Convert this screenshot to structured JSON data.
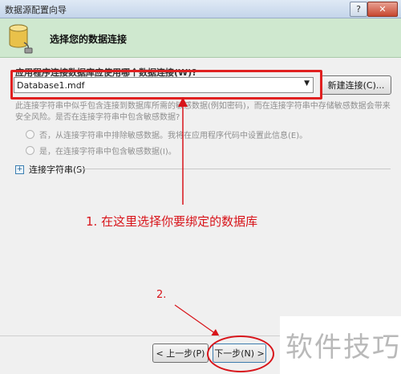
{
  "window": {
    "title": "数据源配置向导",
    "help_glyph": "?",
    "close_glyph": "✕"
  },
  "header": {
    "title": "选择您的数据连接",
    "icon": "database-plug-icon",
    "band_color": "#cfe8cf"
  },
  "connection": {
    "question": "应用程序连接数据库应使用哪个数据连接(W)?",
    "selected": "Database1.mdf",
    "new_button": "新建连接(C)..."
  },
  "sensitive": {
    "text": "此连接字符串中似乎包含连接到数据库所需的敏感数据(例如密码)，而在连接字符串中存储敏感数据会带来安全风险。是否在连接字符串中包含敏感数据?",
    "option_no": "否，从连接字符串中排除敏感数据。我将在应用程序代码中设置此信息(E)。",
    "option_yes": "是，在连接字符串中包含敏感数据(I)。"
  },
  "expander": {
    "label": "连接字符串(S)",
    "glyph": "+"
  },
  "annotations": {
    "step1": "1. 在这里选择你要绑定的数据库",
    "step2": "2.",
    "color": "#d8141a"
  },
  "footer": {
    "prev": "< 上一步(P)",
    "next": "下一步(N) >"
  },
  "watermark": "软件技巧"
}
